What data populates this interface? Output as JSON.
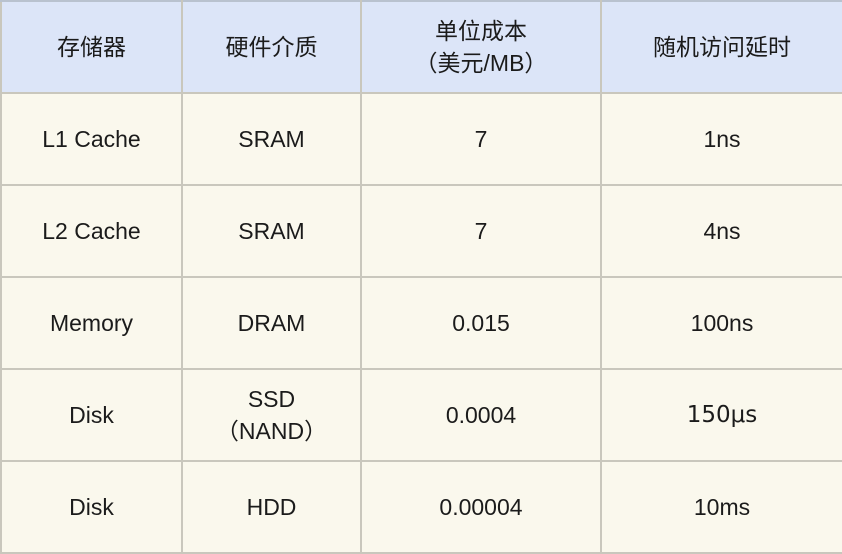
{
  "table": {
    "name": "storage-hierarchy-table",
    "colors": {
      "header_background": "#dce5f8",
      "body_background": "#faf8ed",
      "border": "#c9c7bd",
      "text": "#1b1b1b"
    },
    "columns": [
      {
        "key": "device",
        "label": "存储器",
        "sublabel": ""
      },
      {
        "key": "medium",
        "label": "硬件介质",
        "sublabel": ""
      },
      {
        "key": "cost",
        "label": "单位成本",
        "sublabel": "（美元/MB）"
      },
      {
        "key": "latency",
        "label": "随机访问延时",
        "sublabel": ""
      }
    ],
    "rows": [
      {
        "device": "L1 Cache",
        "device_sub": "",
        "medium": "SRAM",
        "medium_sub": "",
        "cost": "7",
        "latency": "1ns"
      },
      {
        "device": "L2 Cache",
        "device_sub": "",
        "medium": "SRAM",
        "medium_sub": "",
        "cost": "7",
        "latency": "4ns"
      },
      {
        "device": "Memory",
        "device_sub": "",
        "medium": "DRAM",
        "medium_sub": "",
        "cost": "0.015",
        "latency": "100ns"
      },
      {
        "device": "Disk",
        "device_sub": "",
        "medium": "SSD",
        "medium_sub": "（NAND）",
        "cost": "0.0004",
        "latency": "150μs"
      },
      {
        "device": "Disk",
        "device_sub": "",
        "medium": "HDD",
        "medium_sub": "",
        "cost": "0.00004",
        "latency": "10ms"
      }
    ]
  }
}
